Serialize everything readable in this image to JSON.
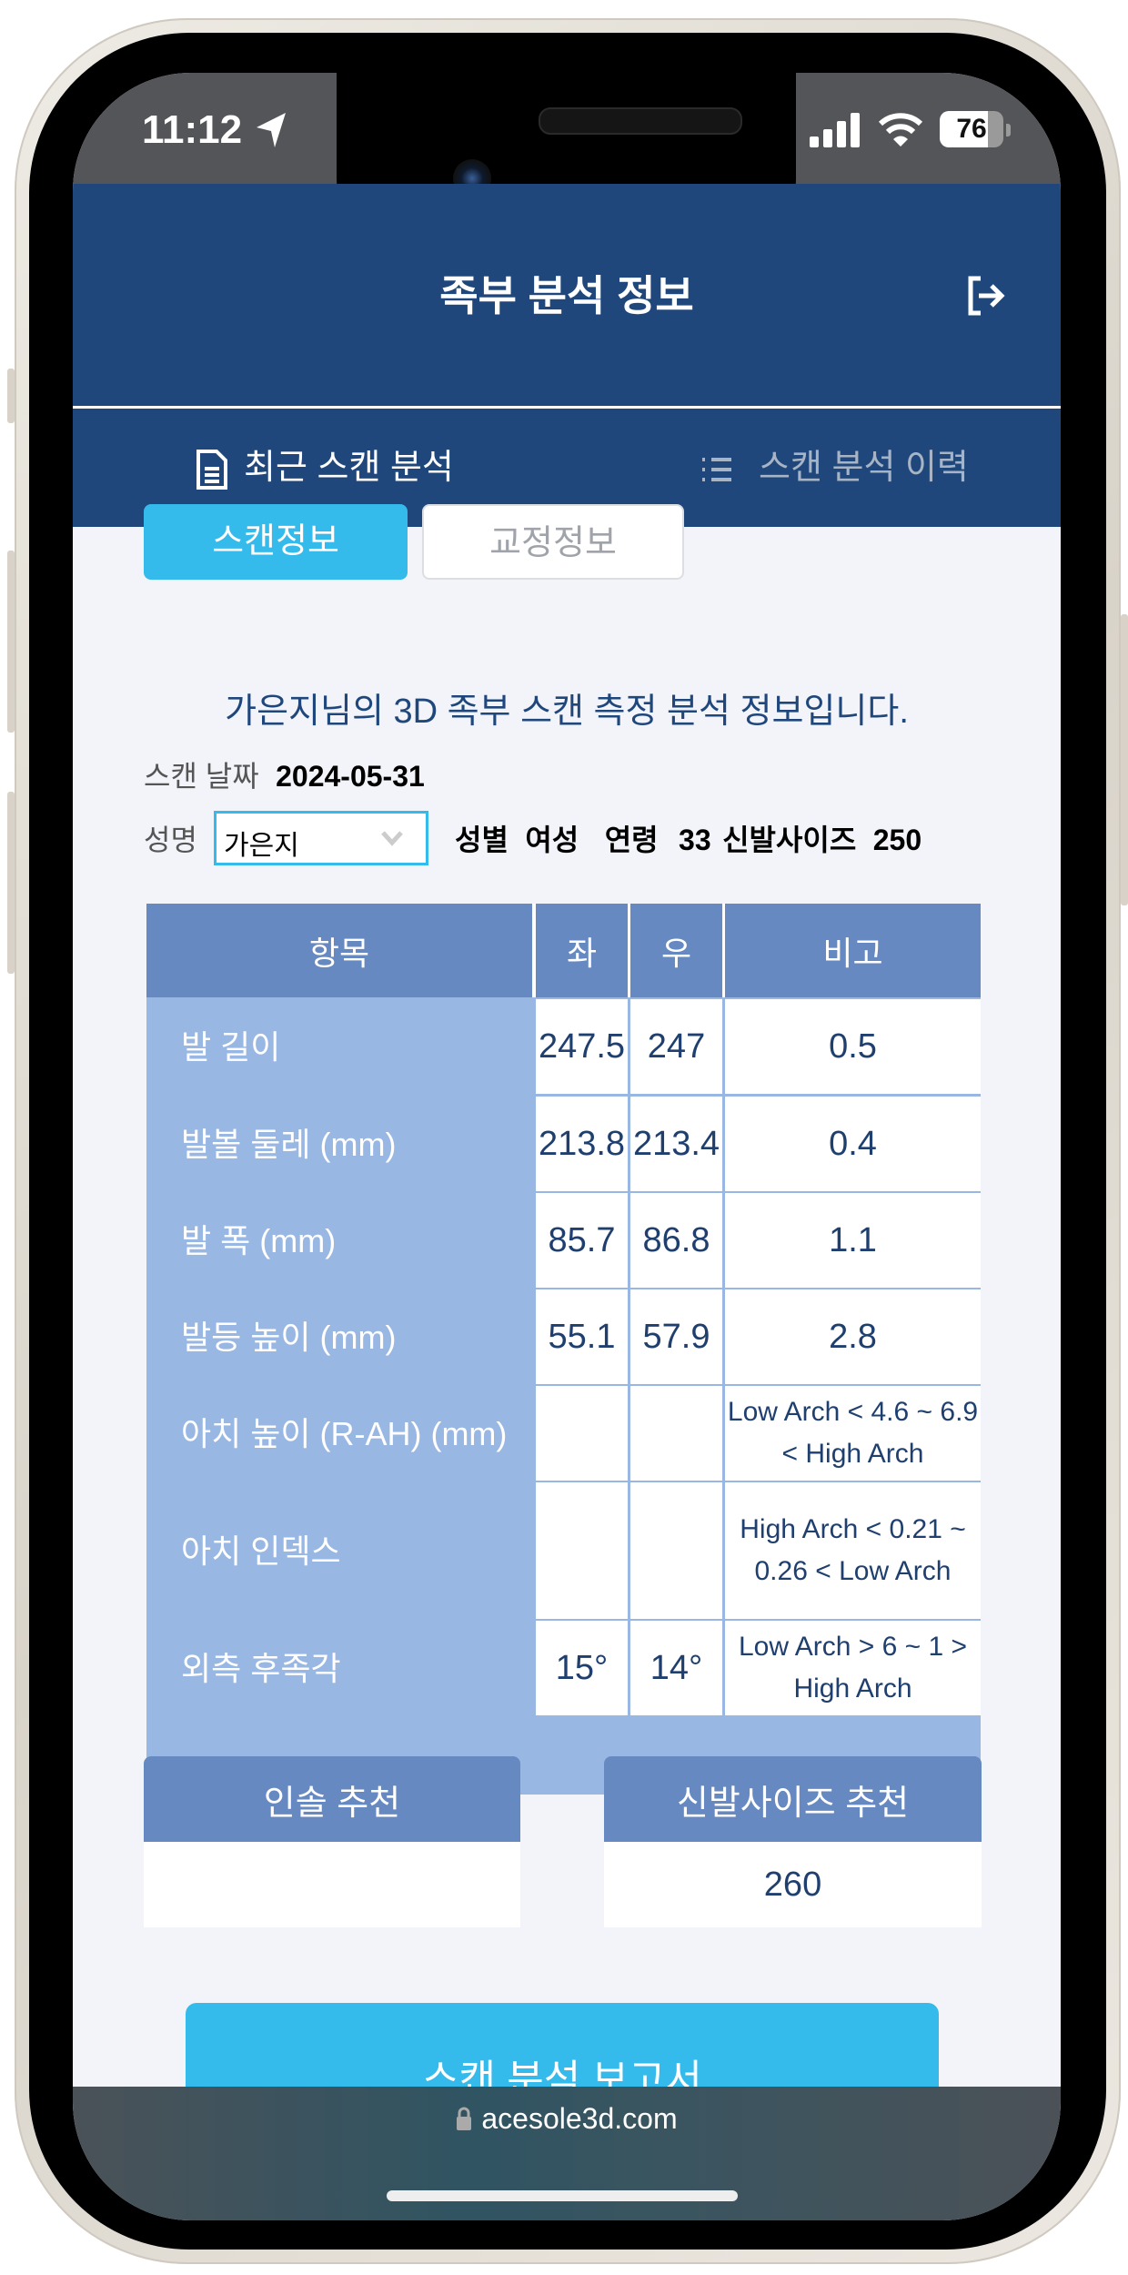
{
  "status_bar": {
    "time": "11:12",
    "battery": "76",
    "location_icon": "location-arrow-icon",
    "signal_icon": "cellular-signal-icon",
    "wifi_icon": "wifi-icon"
  },
  "header": {
    "title": "족부 분석 정보",
    "logout_icon": "logout-icon"
  },
  "nav_tabs": [
    {
      "label": "최근 스캔 분석",
      "icon": "document-icon",
      "active": true
    },
    {
      "label": "스캔 분석 이력",
      "icon": "list-icon",
      "active": false
    }
  ],
  "sub_tabs": [
    {
      "label": "스캔정보",
      "active": true
    },
    {
      "label": "교정정보",
      "active": false
    }
  ],
  "description": "가은지님의 3D 족부 스캔 측정 분석 정보입니다.",
  "info": {
    "scan_date_label": "스캔 날짜",
    "scan_date": "2024-05-31",
    "name_label": "성명",
    "name_value": "가은지",
    "gender_label": "성별",
    "gender": "여성",
    "age_label": "연령",
    "age": "33",
    "shoe_size_label": "신발사이즈",
    "shoe_size": "250"
  },
  "table": {
    "headers": [
      "항목",
      "좌",
      "우",
      "비고"
    ],
    "rows": [
      {
        "item": "발 길이",
        "left": "247.5",
        "right": "247",
        "note": "0.5"
      },
      {
        "item": "발볼 둘레 (mm)",
        "left": "213.8",
        "right": "213.4",
        "note": "0.4"
      },
      {
        "item": "발 폭 (mm)",
        "left": "85.7",
        "right": "86.8",
        "note": "1.1"
      },
      {
        "item": "발등 높이 (mm)",
        "left": "55.1",
        "right": "57.9",
        "note": "2.8"
      },
      {
        "item": "아치 높이 (R-AH) (mm)",
        "left": "",
        "right": "",
        "note": "Low Arch < 4.6 ~ 6.9 < High Arch"
      },
      {
        "item": "아치 인덱스",
        "left": "",
        "right": "",
        "note": "High Arch < 0.21 ~ 0.26 < Low Arch"
      },
      {
        "item": "외측 후족각",
        "left": "15°",
        "right": "14°",
        "note": "Low Arch > 6 ~ 1 > High Arch"
      }
    ]
  },
  "recommendations": {
    "insole_label": "인솔 추천",
    "insole_value": "",
    "shoe_size_label": "신발사이즈 추천",
    "shoe_size_value": "260"
  },
  "report_button": "스캔 분석 보고서",
  "browser": {
    "url": "acesole3d.com"
  },
  "colors": {
    "header": "#1f477b",
    "accent": "#35baec",
    "table_header": "#6689c1",
    "table_label": "#99b7e3",
    "text_value": "#1f3f6e"
  }
}
